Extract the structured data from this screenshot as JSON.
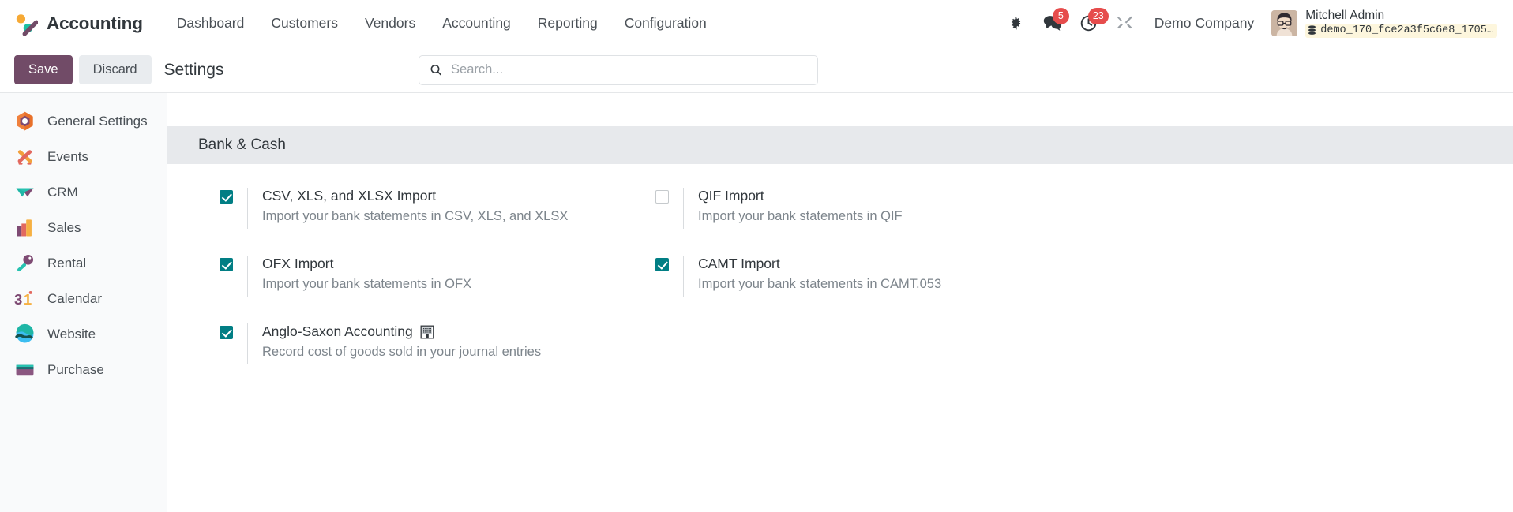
{
  "colors": {
    "brand_purple": "#714b67",
    "accent_teal": "#017e84",
    "badge_red": "#e64c4c",
    "section_band": "#e7e9ec",
    "sidebar_bg": "#f9fafb"
  },
  "navbar": {
    "app_logo_icon": "odoo-accounting-logo-icon",
    "app_name": "Accounting",
    "menu_items": [
      {
        "label": "Dashboard"
      },
      {
        "label": "Customers"
      },
      {
        "label": "Vendors"
      },
      {
        "label": "Accounting"
      },
      {
        "label": "Reporting"
      },
      {
        "label": "Configuration"
      }
    ],
    "system_icons": [
      {
        "name": "bug-icon",
        "badge": null
      },
      {
        "name": "messages-icon",
        "badge": "5"
      },
      {
        "name": "activities-clock-icon",
        "badge": "23"
      },
      {
        "name": "debug-tools-icon",
        "badge": null
      }
    ],
    "company": "Demo Company",
    "user": {
      "avatar_icon": "user-avatar",
      "name": "Mitchell Admin",
      "database_icon": "database-icon",
      "database": "demo_170_fce2a3f5c6e8_1705…"
    }
  },
  "control_panel": {
    "save_label": "Save",
    "discard_label": "Discard",
    "title": "Settings",
    "search": {
      "icon": "search-icon",
      "value": "",
      "placeholder": "Search..."
    }
  },
  "sidebar": {
    "items": [
      {
        "label": "General Settings",
        "icon": "general-settings-icon"
      },
      {
        "label": "Events",
        "icon": "events-icon"
      },
      {
        "label": "CRM",
        "icon": "crm-icon"
      },
      {
        "label": "Sales",
        "icon": "sales-icon"
      },
      {
        "label": "Rental",
        "icon": "rental-icon"
      },
      {
        "label": "Calendar",
        "icon": "calendar-icon"
      },
      {
        "label": "Website",
        "icon": "website-icon"
      },
      {
        "label": "Purchase",
        "icon": "purchase-icon"
      }
    ]
  },
  "main": {
    "section_title": "Bank & Cash",
    "settings": [
      {
        "key": "csv_import",
        "title": "CSV, XLS, and XLSX Import",
        "description": "Import your bank statements in CSV, XLS, and XLSX",
        "checked": true,
        "extra_icon": null
      },
      {
        "key": "qif_import",
        "title": "QIF Import",
        "description": "Import your bank statements in QIF",
        "checked": false,
        "extra_icon": null
      },
      {
        "key": "ofx_import",
        "title": "OFX Import",
        "description": "Import your bank statements in OFX",
        "checked": true,
        "extra_icon": null
      },
      {
        "key": "camt_import",
        "title": "CAMT Import",
        "description": "Import your bank statements in CAMT.053",
        "checked": true,
        "extra_icon": null
      },
      {
        "key": "anglo_saxon",
        "title": "Anglo-Saxon Accounting",
        "description": "Record cost of goods sold in your journal entries",
        "checked": true,
        "extra_icon": "company-building-icon"
      }
    ]
  }
}
